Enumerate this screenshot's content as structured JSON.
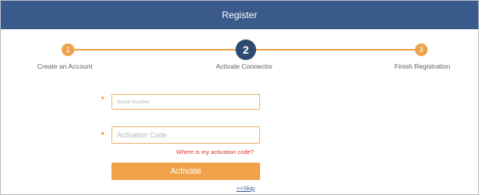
{
  "window": {
    "title": "Register"
  },
  "steps": [
    {
      "number": "1",
      "label": "Create an Account",
      "state": "done"
    },
    {
      "number": "2",
      "label": "Activate Connector",
      "state": "active"
    },
    {
      "number": "3",
      "label": "Finish Registration",
      "state": "pending"
    }
  ],
  "form": {
    "serial_placeholder": "Serial Number",
    "activation_placeholder": "Activation Code",
    "required_marker": "*",
    "help_link": "Where is my activation code?",
    "activate_label": "Activate",
    "skip_label": ">>Skip"
  },
  "colors": {
    "header": "#3a5a8c",
    "accent": "#f0a24a",
    "active_step": "#2f4a70",
    "link_red": "#e0322d"
  }
}
